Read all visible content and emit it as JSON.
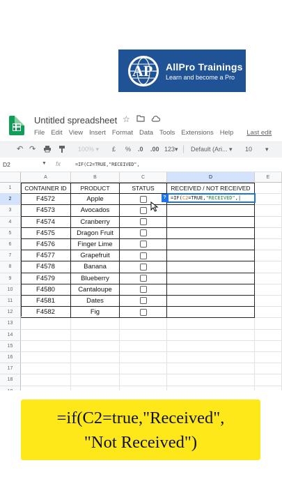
{
  "logo": {
    "letters": "AP",
    "title": "AllPro Trainings",
    "subtitle": "Learn and become a Pro",
    "bg_color": "#1f5396"
  },
  "app": {
    "icon": "sheets-icon",
    "doc_title": "Untitled spreadsheet",
    "title_icons": [
      "star-icon",
      "folder-move-icon",
      "cloud-status-icon"
    ],
    "menu": [
      "File",
      "Edit",
      "View",
      "Insert",
      "Format",
      "Data",
      "Tools",
      "Extensions",
      "Help"
    ],
    "last_edit": "Last edit"
  },
  "toolbar": {
    "zoom": "100%",
    "currency": "£",
    "percent": "%",
    "dec_decrease": ".0",
    "dec_increase": ".00",
    "more_formats": "123",
    "font": "Default (Ari...",
    "font_size": "10"
  },
  "formula_bar": {
    "cell_ref": "D2",
    "fx": "fx",
    "formula": "=IF(C2=TRUE,\"RECEIVED\","
  },
  "grid": {
    "columns": [
      "A",
      "B",
      "C",
      "D",
      "E"
    ],
    "active_column": "D",
    "active_row": 2,
    "row_numbers": [
      "1",
      "2",
      "3",
      "4",
      "5",
      "6",
      "7",
      "8",
      "9",
      "10",
      "11",
      "12",
      "13",
      "14",
      "15",
      "16",
      "17",
      "18",
      "19"
    ],
    "headers": [
      "CONTAINER ID",
      "PRODUCT",
      "STATUS",
      "RECEIVED / NOT RECEIVED"
    ],
    "rows": [
      {
        "id": "F4572",
        "product": "Apple"
      },
      {
        "id": "F4573",
        "product": "Avocados"
      },
      {
        "id": "F4574",
        "product": "Cranberry"
      },
      {
        "id": "F4575",
        "product": "Dragon Fruit"
      },
      {
        "id": "F4576",
        "product": "Finger Lime"
      },
      {
        "id": "F4577",
        "product": "Grapefruit"
      },
      {
        "id": "F4578",
        "product": "Banana"
      },
      {
        "id": "F4579",
        "product": "Blueberry"
      },
      {
        "id": "F4580",
        "product": "Cantaloupe"
      },
      {
        "id": "F4581",
        "product": "Dates"
      },
      {
        "id": "F4582",
        "product": "Fig"
      }
    ],
    "editor": {
      "p1": "=IF(",
      "p2": "C2",
      "p3": "=TRUE,",
      "p4": "\"RECEIVED\"",
      "p5": ",|"
    },
    "help_badge": "?"
  },
  "caption": {
    "line1": "=if(C2=true,\"Received\",",
    "line2": "\"Not Received\")",
    "bg_color": "#ffe81a"
  }
}
